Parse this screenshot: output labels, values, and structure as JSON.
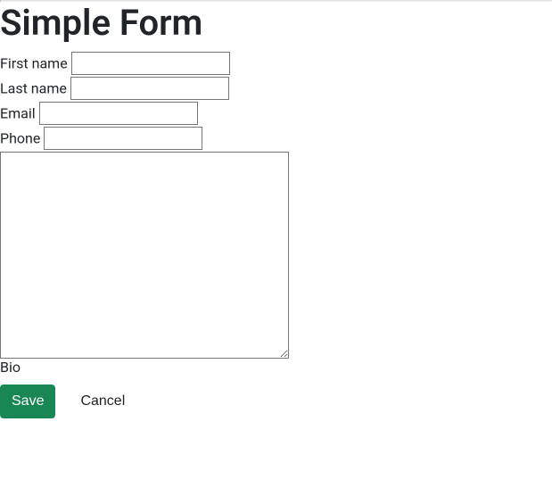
{
  "title": "Simple Form",
  "fields": {
    "first_name_label": "First name",
    "first_name_value": "",
    "last_name_label": "Last name",
    "last_name_value": "",
    "email_label": "Email",
    "email_value": "",
    "phone_label": "Phone",
    "phone_value": "",
    "bio_label": "Bio",
    "bio_value": ""
  },
  "actions": {
    "save_label": "Save",
    "cancel_label": "Cancel"
  }
}
